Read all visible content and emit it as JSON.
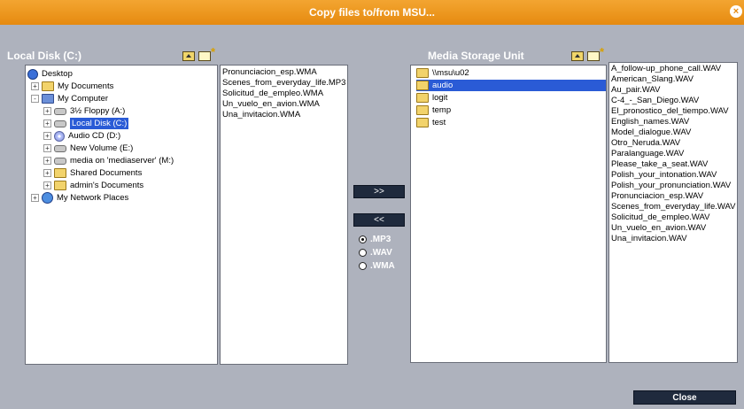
{
  "window": {
    "title": "Copy files to/from MSU...",
    "close_icon": "close-icon"
  },
  "left_panel": {
    "title": "Local Disk (C:)",
    "tree": [
      {
        "label": "Desktop",
        "icon": "desktop-icon",
        "expander": ""
      },
      {
        "label": "My Documents",
        "icon": "folder-icon",
        "expander": "+"
      },
      {
        "label": "My Computer",
        "icon": "computer-icon",
        "expander": "-"
      },
      {
        "label": "3½ Floppy (A:)",
        "icon": "floppy-icon",
        "expander": "+"
      },
      {
        "label": "Local Disk (C:)",
        "icon": "drive-icon",
        "expander": "+",
        "selected": true
      },
      {
        "label": "Audio CD (D:)",
        "icon": "cd-icon",
        "expander": "+"
      },
      {
        "label": "New Volume (E:)",
        "icon": "drive-icon",
        "expander": "+"
      },
      {
        "label": "media on 'mediaserver' (M:)",
        "icon": "network-drive-icon",
        "expander": "+"
      },
      {
        "label": "Shared Documents",
        "icon": "folder-icon",
        "expander": "+"
      },
      {
        "label": "admin's Documents",
        "icon": "folder-icon",
        "expander": "+"
      },
      {
        "label": "My Network Places",
        "icon": "network-places-icon",
        "expander": "+"
      }
    ],
    "files": [
      "Pronunciacion_esp.WMA",
      "Scenes_from_everyday_life.MP3",
      "Solicitud_de_empleo.WMA",
      "Un_vuelo_en_avion.WMA",
      "Una_invitacion.WMA"
    ]
  },
  "middle": {
    "copy_right_label": ">>",
    "copy_left_label": "<<",
    "file_types": [
      {
        "label": ".MP3",
        "checked": true
      },
      {
        "label": ".WAV",
        "checked": false
      },
      {
        "label": ".WMA",
        "checked": false
      }
    ]
  },
  "right_panel": {
    "title": "Media Storage Unit",
    "folders": [
      {
        "label": "\\\\msu\\u02",
        "selected": false
      },
      {
        "label": "audio",
        "selected": true
      },
      {
        "label": "logit",
        "selected": false
      },
      {
        "label": "temp",
        "selected": false
      },
      {
        "label": "test",
        "selected": false
      }
    ],
    "files": [
      "A_follow-up_phone_call.WAV",
      "American_Slang.WAV",
      "Au_pair.WAV",
      "C-4_-_San_Diego.WAV",
      "El_pronostico_del_tiempo.WAV",
      "English_names.WAV",
      "Model_dialogue.WAV",
      "Otro_Neruda.WAV",
      "Paralanguage.WAV",
      "Please_take_a_seat.WAV",
      "Polish_your_intonation.WAV",
      "Polish_your_pronunciation.WAV",
      "Pronunciacion_esp.WAV",
      "Scenes_from_everyday_life.WAV",
      "Solicitud_de_empleo.WAV",
      "Un_vuelo_en_avion.WAV",
      "Una_invitacion.WAV"
    ]
  },
  "footer": {
    "close_label": "Close"
  }
}
